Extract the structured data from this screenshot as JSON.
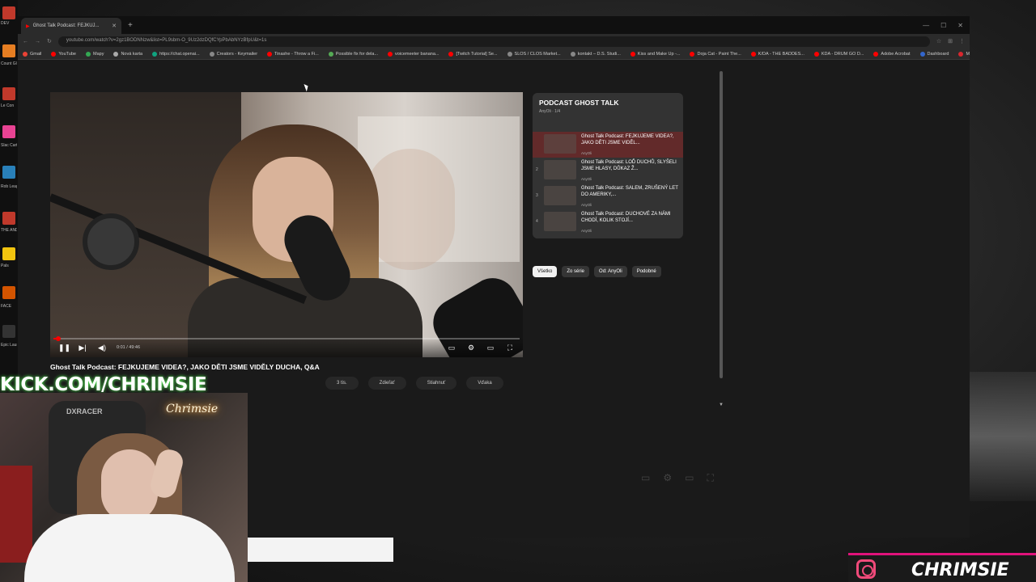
{
  "browser": {
    "tab_title": "Ghost Talk Podcast: FEJKUJ...",
    "url": "youtube.com/watch?v=2gz1BODNNzw&list=PL9sbm-O_9Uz2dzDQfCYpPbAbNYzBfpU&t=1s",
    "bookmarks": [
      {
        "label": "Gmail",
        "color": "#e94235"
      },
      {
        "label": "YouTube",
        "color": "#ff0000"
      },
      {
        "label": "Mapy",
        "color": "#34a853"
      },
      {
        "label": "Nová karta",
        "color": "#aaaaaa"
      },
      {
        "label": "https://chat.openai...",
        "color": "#10a37f"
      },
      {
        "label": "Creators - Keymailer",
        "color": "#888888"
      },
      {
        "label": "Tinashe - Throw a Fi...",
        "color": "#ff0000"
      },
      {
        "label": "Possible fix for dela...",
        "color": "#55aa55"
      },
      {
        "label": "voicemeeter banana...",
        "color": "#ff0000"
      },
      {
        "label": "[Twitch Tutorial] Se...",
        "color": "#ff0000"
      },
      {
        "label": "SLOS / CLOS Market...",
        "color": "#888888"
      },
      {
        "label": "kontakt – D.S. Studi...",
        "color": "#888888"
      },
      {
        "label": "Kiss and Make Up -...",
        "color": "#ff0000"
      },
      {
        "label": "Doja Cat - Paint The...",
        "color": "#ff0000"
      },
      {
        "label": "K/DA - THE BADDES...",
        "color": "#ff0000"
      },
      {
        "label": "KDA - DRUM GO D...",
        "color": "#ff0000"
      },
      {
        "label": "Adobe Acrobat",
        "color": "#ff0000"
      },
      {
        "label": "Dashboard",
        "color": "#3366cc"
      },
      {
        "label": "MEGA",
        "color": "#d9272e"
      }
    ]
  },
  "video": {
    "title": "Ghost Talk Podcast: FEJKUJEME VIDEA?, JAKO DĚTI JSME VIDĚLY DUCHA, Q&A",
    "time": "0:01 / 49:46",
    "progress_fraction": 0.01
  },
  "playlist": {
    "title": "PODCAST GHOST TALK",
    "subtitle": "AnyOli · 1/4",
    "items": [
      {
        "num": "",
        "title": "Ghost Talk Podcast: FEJKUJEME VIDEA?, JAKO DĚTI JSME VIDĚL...",
        "channel": "AnyOli"
      },
      {
        "num": "2",
        "title": "Ghost Talk Podcast: LOĎ DUCHŮ, SLYŠELI JSME HLASY, DŮKAZ Ž...",
        "channel": "AnyOli"
      },
      {
        "num": "3",
        "title": "Ghost Talk Podcast: SALEM, ZRUŠENÝ LET DO AMERIKY,...",
        "channel": "AnyOli"
      },
      {
        "num": "4",
        "title": "Ghost Talk Podcast: DUCHOVÉ ZA NÁMI CHODÍ, KOLIK STOJÍ...",
        "channel": "AnyOli"
      }
    ]
  },
  "chips": [
    "Všetko",
    "Zo série",
    "Od: AnyOli",
    "Podobné"
  ],
  "actions": [
    "3 tis.",
    "Zdieľať",
    "Stiahnuť",
    "Vďaka"
  ],
  "overlay": {
    "kick": "KICK.COM/CHRIMSIE",
    "neon": "Chrimsie",
    "chair_brand": "DXRACER",
    "insta_name": "CHRIMSIE"
  },
  "desktop_labels": [
    "DEV",
    "Count Globa",
    "Le Con",
    "Slac Cart",
    "Rob Leag",
    "THE AND",
    "Pals",
    "FACE",
    "Epic Laun"
  ]
}
